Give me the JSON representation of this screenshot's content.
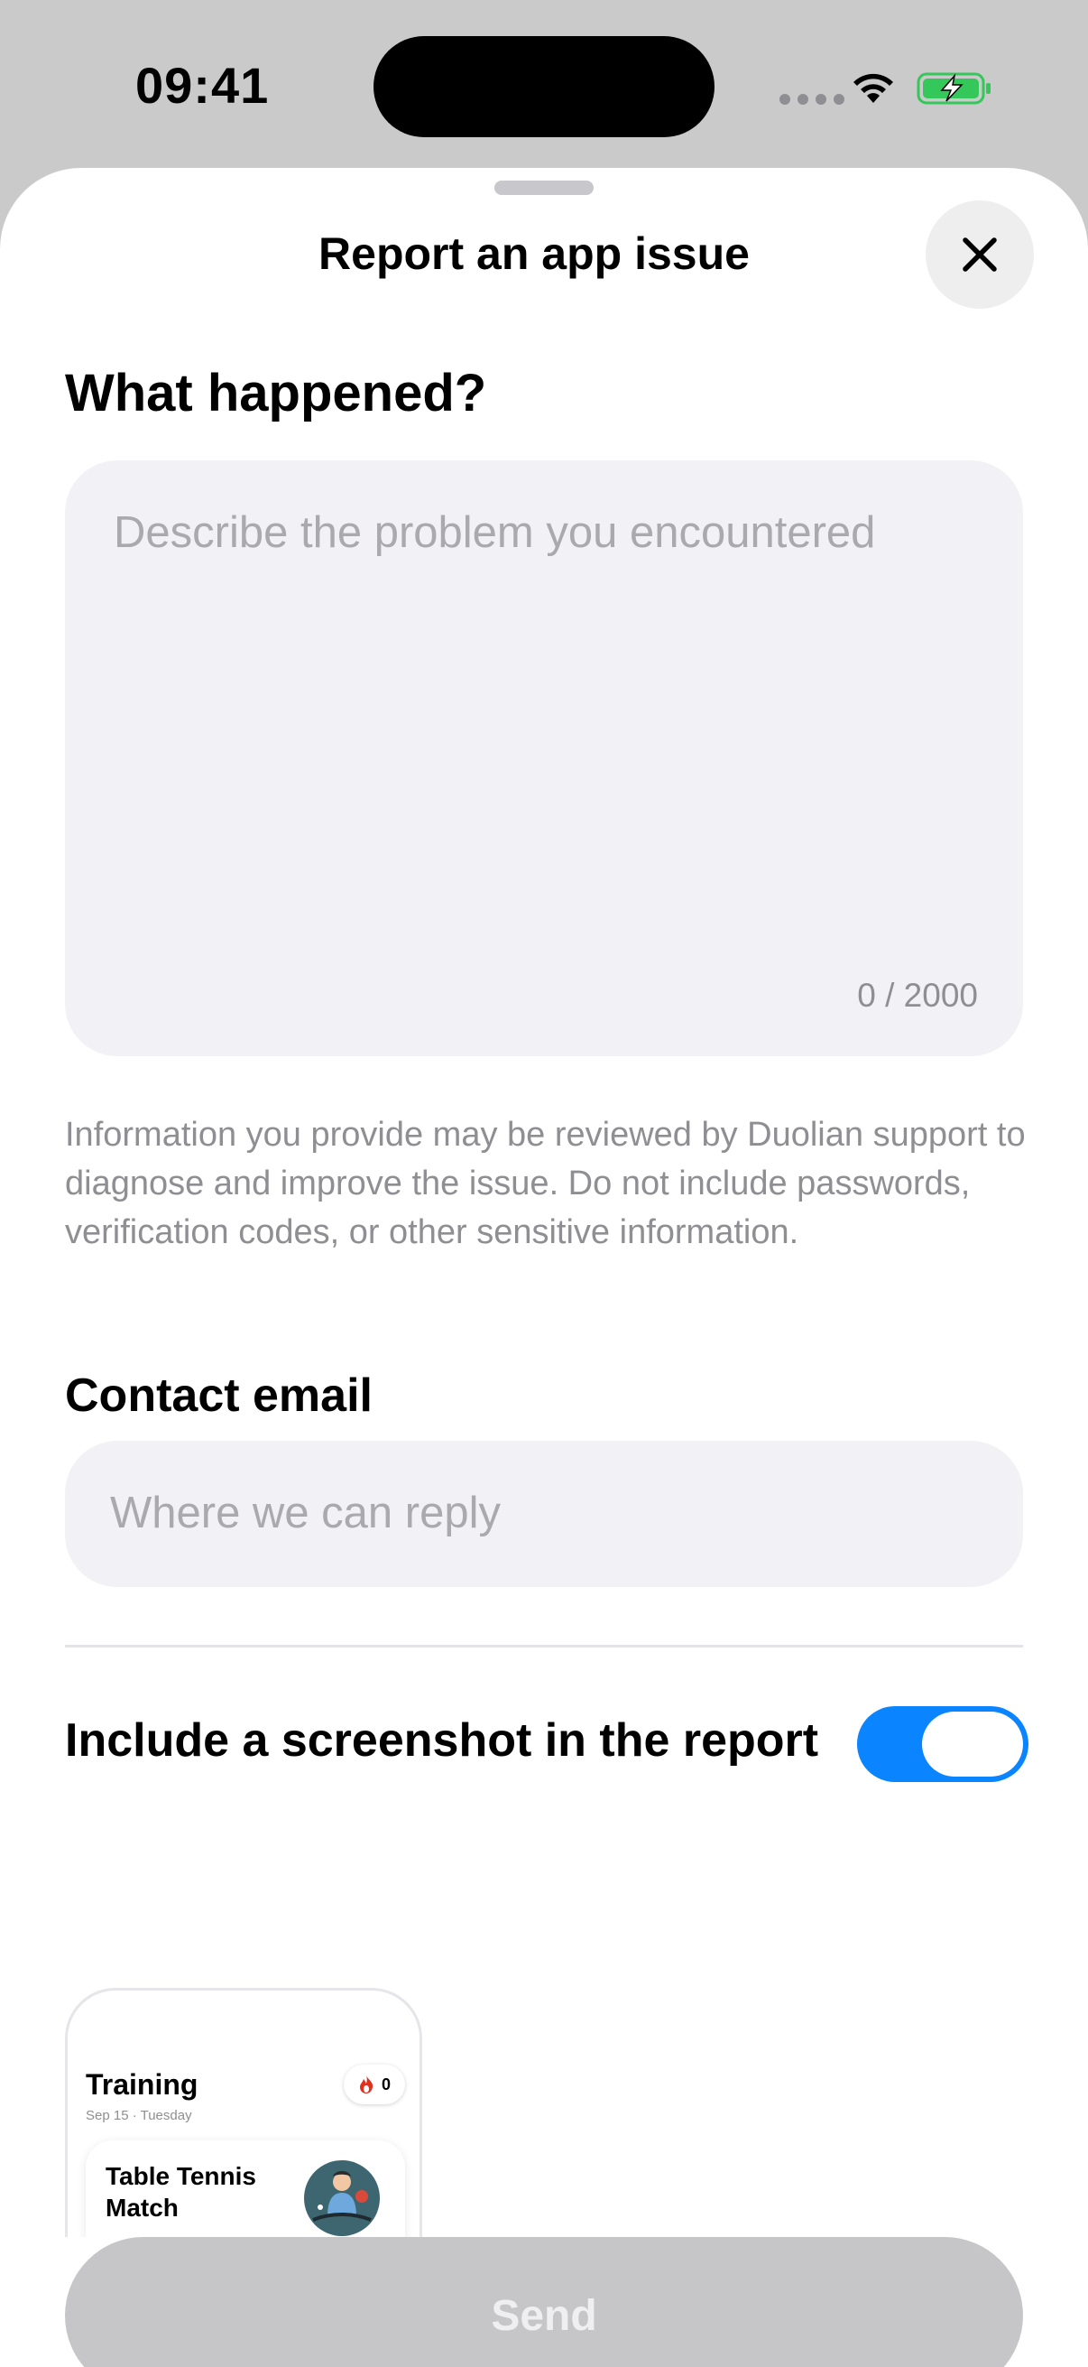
{
  "status_bar": {
    "time": "09:41"
  },
  "sheet": {
    "title": "Report an app issue",
    "close_icon": "close-icon"
  },
  "description": {
    "heading": "What happened?",
    "placeholder": "Describe the problem you encountered",
    "counter": "0 / 2000",
    "disclaimer": "Information you provide may be reviewed by Duolian support to diagnose and improve the issue. Do not include passwords, verification codes, or other sensitive information."
  },
  "contact": {
    "heading": "Contact email",
    "placeholder": "Where we can reply"
  },
  "screenshot": {
    "label": "Include a screenshot in the report",
    "toggle_on": true,
    "toggle_color": "#0a84ff",
    "preview": {
      "title": "Training",
      "date": "Sep 15 · Tuesday",
      "streak_count": "0",
      "card_title": "Table Tennis Match"
    }
  },
  "actions": {
    "send_label": "Send"
  },
  "colors": {
    "accent": "#0a84ff",
    "battery": "#34c759",
    "disabled_button": "#c6c6c8",
    "field_background": "#f2f2f6"
  }
}
